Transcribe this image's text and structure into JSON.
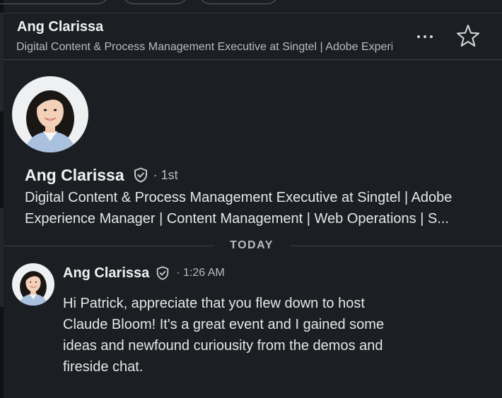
{
  "header": {
    "name": "Ang Clarissa",
    "headline": "Digital Content & Process Management Executive at Singtel | Adobe Experience Manager | Content Management | Web Operations",
    "more_icon": "more-horizontal-icon",
    "star_icon": "star-outline-icon"
  },
  "profile": {
    "name": "Ang Clarissa",
    "verified_icon": "verified-shield-icon",
    "degree": "· 1st",
    "headline_line1": "Digital Content & Process Management Executive at Singtel | Adobe",
    "headline_line2": "Experience Manager | Content Management | Web Operations | S..."
  },
  "divider": {
    "label": "TODAY"
  },
  "message": {
    "sender": "Ang Clarissa",
    "time": "· 1:26 AM",
    "lines": [
      "Hi Patrick, appreciate that you flew down to host",
      "Claude Bloom! It's a great event and I gained some",
      "ideas and newfound curiousity from the demos and",
      "fireside chat."
    ]
  },
  "colors": {
    "background": "#1b1f23",
    "divider": "#3b4045",
    "text_primary": "#f2f2f2",
    "text_secondary": "#b9bcbf"
  }
}
